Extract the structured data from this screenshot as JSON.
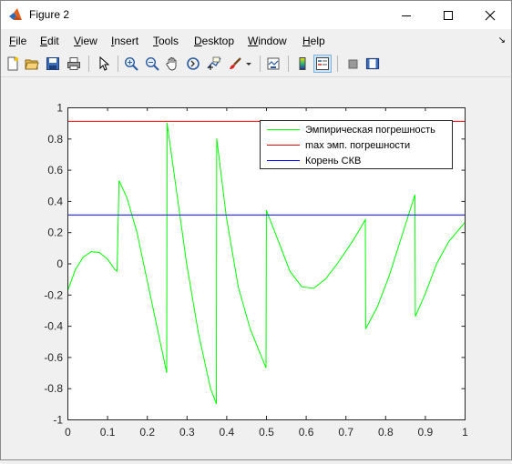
{
  "window": {
    "title": "Figure 2",
    "controls": {
      "minimize": "minimize",
      "maximize": "maximize",
      "close": "close"
    }
  },
  "menu": {
    "items": [
      "File",
      "Edit",
      "View",
      "Insert",
      "Tools",
      "Desktop",
      "Window",
      "Help"
    ],
    "dock_arrow": "↘"
  },
  "toolbar": {
    "buttons": [
      "new-figure-icon",
      "open-file-icon",
      "save-icon",
      "print-icon",
      "edit-plot-arrow-icon",
      "zoom-in-icon",
      "zoom-out-icon",
      "pan-hand-icon",
      "rotate-3d-icon",
      "data-cursor-icon",
      "brush-icon",
      "brush-dropdown-icon",
      "link-plot-icon",
      "insert-colorbar-icon",
      "insert-legend-icon",
      "hide-plot-tools-icon",
      "show-plot-tools-icon"
    ]
  },
  "colors": {
    "empirical": "#00ff00",
    "max": "#ff0000",
    "rms": "#0000ff",
    "axes_bg": "#ffffff",
    "figure_bg": "#f0f0f0"
  },
  "chart_data": {
    "type": "line",
    "title": "",
    "xlabel": "",
    "ylabel": "",
    "xlim": [
      0,
      1
    ],
    "ylim": [
      -1,
      1
    ],
    "xticks": [
      "0",
      "0.1",
      "0.2",
      "0.3",
      "0.4",
      "0.5",
      "0.6",
      "0.7",
      "0.8",
      "0.9",
      "1"
    ],
    "yticks": [
      "1",
      "0.8",
      "0.6",
      "0.4",
      "0.2",
      "0",
      "-0.2",
      "-0.4",
      "-0.6",
      "-0.8",
      "-1"
    ],
    "grid": false,
    "legend_position": "top-right",
    "series": [
      {
        "name": "Эмпирическая погрешность",
        "color": "#00ff00",
        "x": [
          0,
          0.02,
          0.04,
          0.06,
          0.08,
          0.1,
          0.12,
          0.125,
          0.13,
          0.15,
          0.175,
          0.2,
          0.225,
          0.25,
          0.251,
          0.27,
          0.3,
          0.33,
          0.36,
          0.375,
          0.376,
          0.4,
          0.43,
          0.46,
          0.5,
          0.501,
          0.53,
          0.56,
          0.59,
          0.62,
          0.65,
          0.68,
          0.72,
          0.75,
          0.751,
          0.78,
          0.81,
          0.84,
          0.875,
          0.876,
          0.9,
          0.93,
          0.96,
          1.0
        ],
        "y": [
          -0.18,
          -0.04,
          0.04,
          0.075,
          0.07,
          0.03,
          -0.04,
          -0.05,
          0.53,
          0.42,
          0.2,
          -0.1,
          -0.4,
          -0.7,
          0.9,
          0.55,
          0.0,
          -0.45,
          -0.8,
          -0.9,
          0.8,
          0.3,
          -0.15,
          -0.42,
          -0.67,
          0.34,
          0.15,
          -0.05,
          -0.15,
          -0.16,
          -0.1,
          0.0,
          0.15,
          0.28,
          -0.42,
          -0.28,
          -0.08,
          0.16,
          0.44,
          -0.34,
          -0.2,
          0.0,
          0.14,
          0.26
        ]
      },
      {
        "name": "max эмп. погрешности",
        "color": "#ff0000",
        "x": [
          0,
          1
        ],
        "y": [
          0.91,
          0.91
        ]
      },
      {
        "name": "Корень СКВ",
        "color": "#0000ff",
        "x": [
          0,
          1
        ],
        "y": [
          0.31,
          0.31
        ]
      }
    ]
  }
}
